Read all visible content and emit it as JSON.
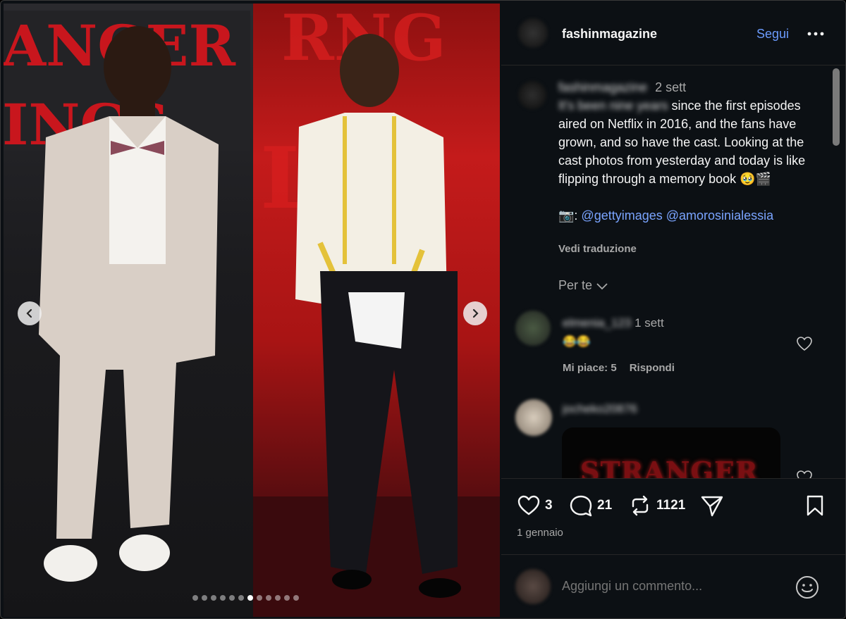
{
  "post": {
    "username": "fashinmagazine",
    "follow_label": "Segui",
    "more_icon": "more-horizontal-icon"
  },
  "media": {
    "slide_count": 12,
    "active_slide": 6,
    "left_sign_text": "STRANGER THINGS",
    "prev_icon": "chevron-left-icon",
    "next_icon": "chevron-right-icon"
  },
  "caption": {
    "author_blurred": "fashinmagazine",
    "age": "2 sett",
    "blurred_start": "It's been nine years",
    "text": " since the first episodes aired on Netflix in 2016, and the fans have grown, and so have the cast. Looking at the cast photos from yesterday and today is like flipping through a memory book 🥹🎬",
    "credit_prefix": "📷: ",
    "mention_1": "@gettyimages",
    "mention_2": "@amorosinialessia",
    "translate_label": "Vedi traduzione",
    "for_you_label": "Per te"
  },
  "comments": [
    {
      "author_blurred": "elmenia_123",
      "age": "1 sett",
      "text": "😂😂",
      "likes_label": "Mi piace: 5",
      "reply_label": "Rispondi"
    },
    {
      "author_blurred": "jocheko20876",
      "card_text": "STRANGER"
    }
  ],
  "actions": {
    "likes": "3",
    "comments": "21",
    "reposts": "1121",
    "date": "1 gennaio"
  },
  "comment_box": {
    "placeholder": "Aggiungi un commento..."
  },
  "colors": {
    "background": "#0c1014",
    "accent_link": "#6b9bfd",
    "muted_text": "#a8a8a8"
  }
}
